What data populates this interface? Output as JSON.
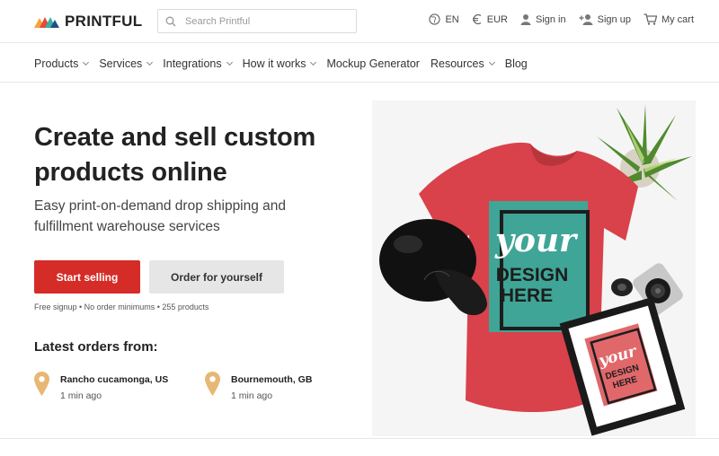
{
  "brand": {
    "name": "PRINTFUL"
  },
  "search": {
    "placeholder": "Search Printful"
  },
  "top_actions": [
    {
      "icon": "globe-icon",
      "label": "EN"
    },
    {
      "icon": "euro-icon",
      "label": "EUR"
    },
    {
      "icon": "user-icon",
      "label": "Sign in"
    },
    {
      "icon": "add-user-icon",
      "label": "Sign up"
    },
    {
      "icon": "cart-icon",
      "label": "My cart"
    }
  ],
  "nav": [
    {
      "label": "Products",
      "dropdown": true
    },
    {
      "label": "Services",
      "dropdown": true
    },
    {
      "label": "Integrations",
      "dropdown": true
    },
    {
      "label": "How it works",
      "dropdown": true
    },
    {
      "label": "Mockup Generator",
      "dropdown": false
    },
    {
      "label": "Resources",
      "dropdown": true
    },
    {
      "label": "Blog",
      "dropdown": false
    }
  ],
  "hero": {
    "title": "Create and sell custom products online",
    "subtitle": "Easy print-on-demand drop shipping and fulfillment warehouse services",
    "primary_button": "Start selling",
    "secondary_button": "Order for yourself",
    "fine_print": "Free signup • No order minimums • 255 products"
  },
  "latest_orders": {
    "title": "Latest orders from:",
    "items": [
      {
        "location": "Rancho cucamonga, US",
        "time": "1 min ago"
      },
      {
        "location": "Bournemouth, GB",
        "time": "1 min ago"
      }
    ]
  },
  "hero_image": {
    "shirt_text_line1": "your",
    "shirt_text_line2": "DESIGN",
    "shirt_text_line3": "HERE"
  },
  "colors": {
    "accent": "#d52c27",
    "tshirt": "#d9424a",
    "print_teal": "#3fa596",
    "pin": "#e7b774"
  }
}
